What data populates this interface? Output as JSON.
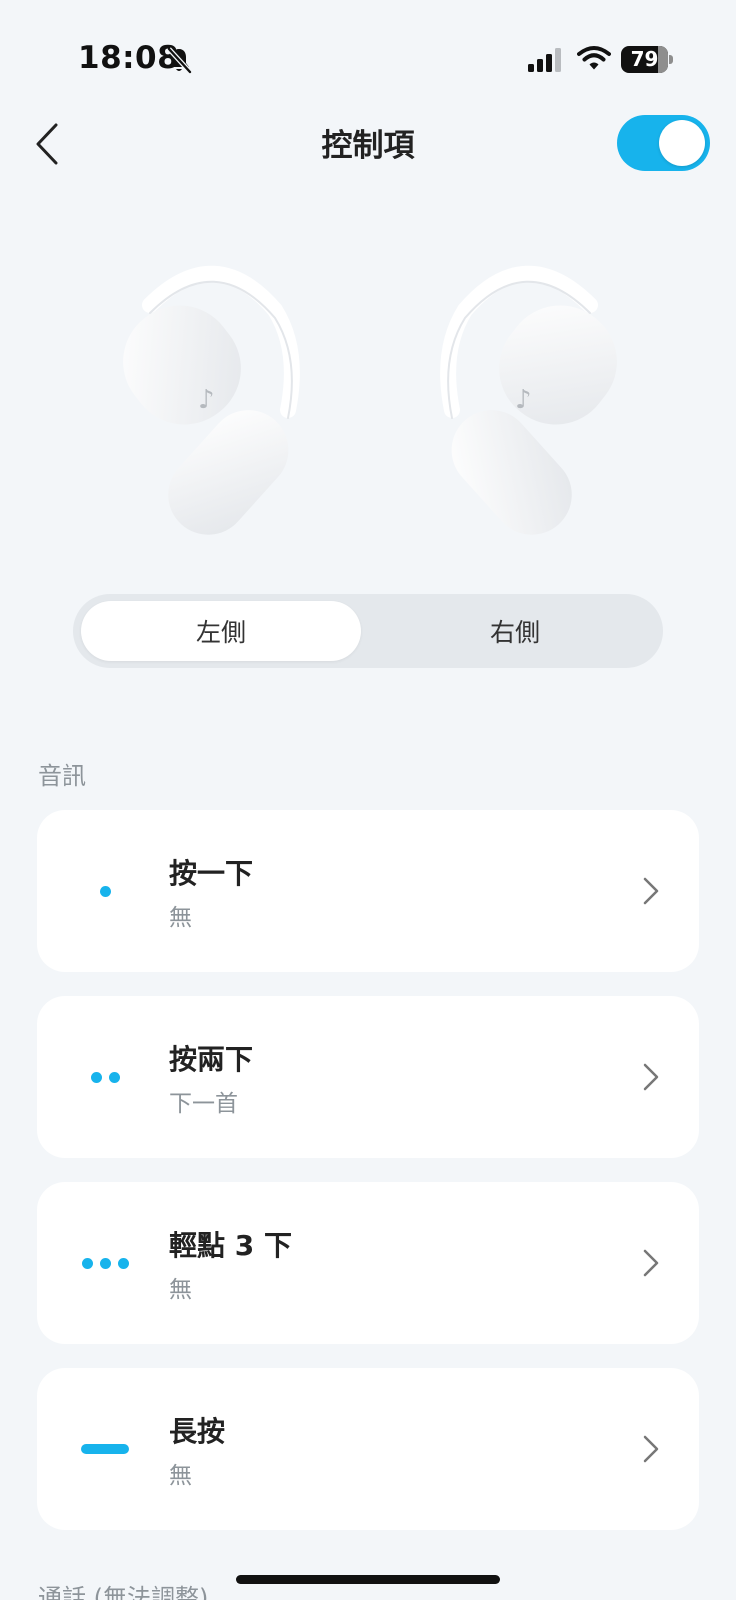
{
  "status_bar": {
    "time": "18:08",
    "battery_level": "79",
    "battery_fraction": 0.79
  },
  "header": {
    "title": "控制項",
    "toggle_on": true,
    "accent_color": "#17b3ec"
  },
  "segmented": {
    "left_label": "左側",
    "right_label": "右側",
    "selected": "左側"
  },
  "audio_section": {
    "label": "音訊",
    "rows": [
      {
        "icon": "single-dot-icon",
        "title": "按一下",
        "value": "無"
      },
      {
        "icon": "double-dot-icon",
        "title": "按兩下",
        "value": "下一首"
      },
      {
        "icon": "triple-dot-icon",
        "title": "輕點 3 下",
        "value": "無"
      },
      {
        "icon": "long-press-icon",
        "title": "長按",
        "value": "無"
      }
    ]
  },
  "call_section": {
    "label": "通話 (無法調整)"
  }
}
